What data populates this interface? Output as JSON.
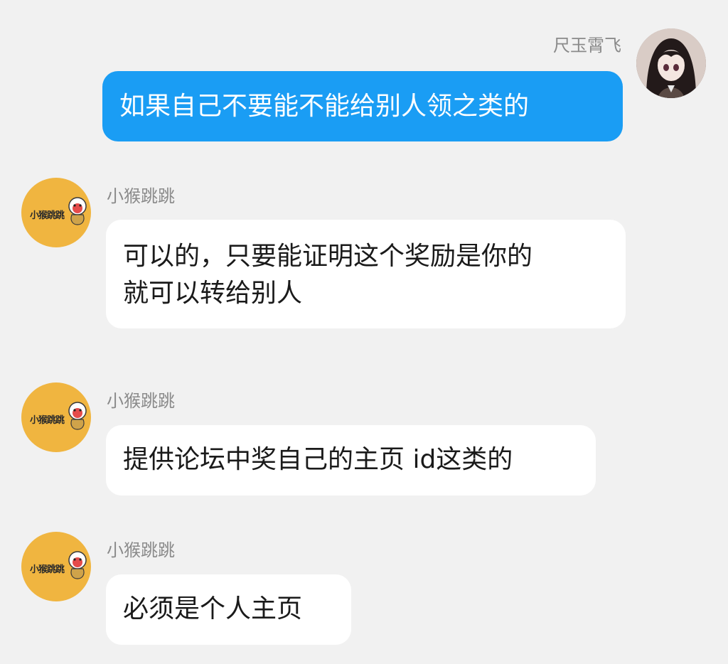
{
  "messages": [
    {
      "sender": "尺玉霄飞",
      "text": "如果自己不要能不能给别人领之类的",
      "is_self": true,
      "avatar_icon": "anime-girl-avatar"
    },
    {
      "sender": "小猴跳跳",
      "text": "可以的，只要能证明这个奖励是你的\n就可以转给别人",
      "is_self": false,
      "avatar_icon": "monkey-logo-avatar",
      "avatar_label": "小猴跳跳"
    },
    {
      "sender": "小猴跳跳",
      "text": "提供论坛中奖自己的主页 id这类的",
      "is_self": false,
      "avatar_icon": "monkey-logo-avatar",
      "avatar_label": "小猴跳跳"
    },
    {
      "sender": "小猴跳跳",
      "text": "必须是个人主页",
      "is_self": false,
      "avatar_icon": "monkey-logo-avatar",
      "avatar_label": "小猴跳跳"
    }
  ],
  "colors": {
    "background": "#f1f1f1",
    "self_bubble": "#1a9df4",
    "other_bubble": "#ffffff",
    "sender_name": "#8a8a8a",
    "avatar_bot_bg": "#f0b540"
  }
}
